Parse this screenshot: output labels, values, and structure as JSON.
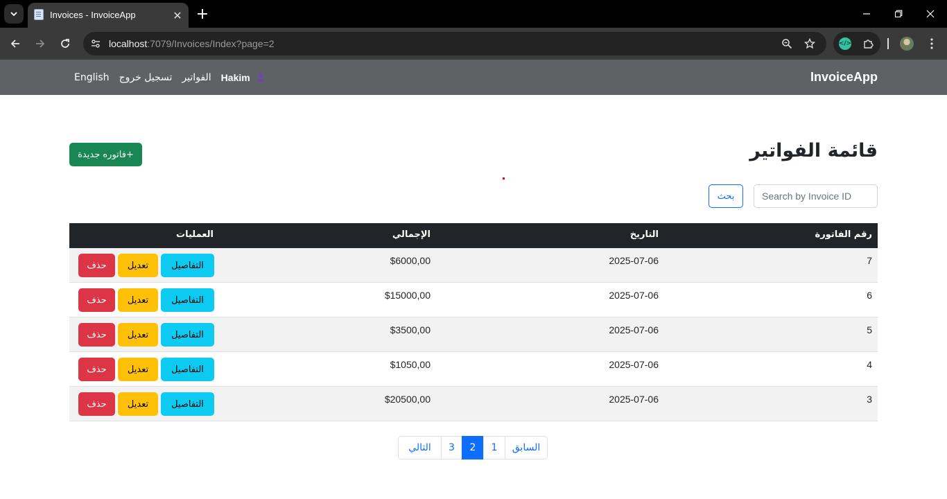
{
  "browser": {
    "tab_title": "Invoices - InvoiceApp",
    "url_host": "localhost",
    "url_rest": ":7079/Invoices/Index?page=2"
  },
  "navbar": {
    "brand": "InvoiceApp",
    "user": "Hakim",
    "invoices_link": "الفواتير",
    "logout_link": "تسجيل خروج",
    "language_link": "English"
  },
  "page": {
    "title": "قائمة الفواتير",
    "new_invoice_button": "+فاتوره جديدة",
    "search_placeholder": "Search by Invoice ID",
    "search_button": "بحث"
  },
  "table": {
    "headers": {
      "id": "رقم الفاتورة",
      "date": "التاريخ",
      "total": "الإجمالي",
      "actions": "العمليات"
    },
    "action_labels": {
      "details": "التفاصيل",
      "edit": "تعديل",
      "delete": "حذف"
    },
    "rows": [
      {
        "id": "7",
        "date": "2025-07-06",
        "total": "$6000,00"
      },
      {
        "id": "6",
        "date": "2025-07-06",
        "total": "$15000,00"
      },
      {
        "id": "5",
        "date": "2025-07-06",
        "total": "$3500,00"
      },
      {
        "id": "4",
        "date": "2025-07-06",
        "total": "$1050,00"
      },
      {
        "id": "3",
        "date": "2025-07-06",
        "total": "$20500,00"
      }
    ]
  },
  "pagination": {
    "next": "التالي",
    "pages": [
      "3",
      "2",
      "1"
    ],
    "current": "2",
    "previous": "السابق"
  },
  "colors": {
    "navbar": "#5f6164",
    "success": "#198754",
    "primary": "#0d6efd",
    "danger": "#dc3545",
    "warning": "#ffc107",
    "info": "#0dcaf0",
    "table_header": "#212529"
  }
}
